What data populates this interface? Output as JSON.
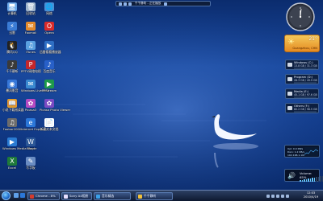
{
  "desktop": {
    "icons": [
      {
        "label": "计算机",
        "glyph": "🖥",
        "color": "#6aa7e8"
      },
      {
        "label": "回收站",
        "glyph": "🗑",
        "color": "#9fb4cc"
      },
      {
        "label": "网络",
        "glyph": "🌐",
        "color": "#4c8fd6"
      },
      {
        "label": "迅雷",
        "glyph": "⚡",
        "color": "#3a7bd5"
      },
      {
        "label": "Foxmail",
        "glyph": "✉",
        "color": "#e28a2d"
      },
      {
        "label": "Opera",
        "glyph": "O",
        "color": "#d92b2b"
      },
      {
        "label": "腾讯QQ",
        "glyph": "🐧",
        "color": "#222"
      },
      {
        "label": "iTunes",
        "glyph": "♫",
        "color": "#5aa0e0"
      },
      {
        "label": "迅雷看看播放器",
        "glyph": "▶",
        "color": "#2f6fc4"
      },
      {
        "label": "千千静听",
        "glyph": "♪",
        "color": "#3a3a3a"
      },
      {
        "label": "PPTV网络电视",
        "glyph": "P",
        "color": "#c4262b"
      },
      {
        "label": "百度音乐",
        "glyph": "♪",
        "color": "#2860c8"
      },
      {
        "label": "暴风影音",
        "glyph": "◉",
        "color": "#3777d8"
      },
      {
        "label": "Windows Live Mail",
        "glyph": "✉",
        "color": "#3a8ad0"
      },
      {
        "label": "PPStream",
        "glyph": "▶",
        "color": "#1e9a4a"
      },
      {
        "label": "小说下载阅读器",
        "glyph": "📖",
        "color": "#e09c2d"
      },
      {
        "label": "Picasa3",
        "glyph": "✿",
        "color": "#b54ac2"
      },
      {
        "label": "Picasa Photo Viewer",
        "glyph": "✿",
        "color": "#7a4ac2"
      },
      {
        "label": "Foobar2000",
        "glyph": "♫",
        "color": "#6c6c6c"
      },
      {
        "label": "Internet Explorer",
        "glyph": "e",
        "color": "#2b77d8"
      },
      {
        "label": "新建文本文档",
        "glyph": "📄",
        "color": "#ffffff"
      },
      {
        "label": "Windows Media Player",
        "glyph": "▶",
        "color": "#2a7bd2"
      },
      {
        "label": "Word",
        "glyph": "W",
        "color": "#2b5797"
      },
      {
        "label": "Excel",
        "glyph": "X",
        "color": "#1f7a3a"
      },
      {
        "label": "写字板",
        "glyph": "✎",
        "color": "#6a8cc2"
      }
    ]
  },
  "media_bar": {
    "title": "千千静听 - 正在播放"
  },
  "clock_gadget": {
    "time": "12:03"
  },
  "weather": {
    "temp": "21°",
    "city": "Guangzhou, CHN",
    "icon": "sun-icon"
  },
  "drives": [
    {
      "name": "Windows (C:)",
      "info": "13.8 GB / 31.3 GB",
      "used": 0.56
    },
    {
      "name": "Program (D:)",
      "info": "28.3 GB / 49.9 GB",
      "used": 0.43
    },
    {
      "name": "Media (E:)",
      "info": "45.1 GB / 97.6 GB",
      "used": 0.54
    },
    {
      "name": "Others (F:)",
      "info": "60.2 GB / 98.5 GB",
      "used": 0.39
    }
  ],
  "network": {
    "up": "Upl: 0.9 KB/s",
    "down": "Dwn: 1.2 KB/s",
    "ip": "192.168.1.100"
  },
  "volume": {
    "label": "Volume: 65%",
    "level": 0.65
  },
  "taskbar": {
    "buttons": [
      {
        "label": "Chrome - 8% 下载中",
        "color": "#d43b2d"
      },
      {
        "label": "Sony A4相册",
        "color": "#e8e0ff"
      },
      {
        "label": "音乐精选",
        "color": "#3aa0e8"
      },
      {
        "label": "千千静听",
        "color": "#f2c13a"
      }
    ],
    "clock_time": "12:03",
    "clock_date": "2010/4/19"
  },
  "colors": {
    "desktop_bg": "#123a86",
    "taskbar": "#1b2c4f",
    "accent": "#4db1ff"
  }
}
